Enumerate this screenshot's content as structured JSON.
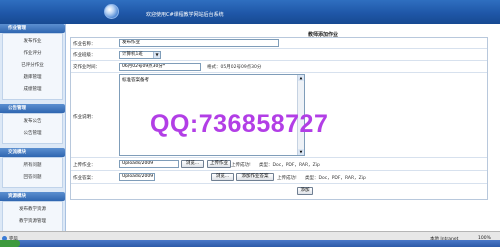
{
  "header": {
    "title": "欢迎使用C#课程教学网站后台系统"
  },
  "sidebar": {
    "sections": [
      {
        "title": "作业管理",
        "items": [
          "发布作业",
          "作业评分",
          "已评分作业",
          "题库管理",
          "成绩管理"
        ]
      },
      {
        "title": "公告管理",
        "items": [
          "发布公告",
          "公告管理"
        ]
      },
      {
        "title": "交流模块",
        "items": [
          "所有问题",
          "回答问题"
        ]
      },
      {
        "title": "资源模块",
        "items": [
          "发布教学资源",
          "教学资源管理"
        ]
      }
    ]
  },
  "form": {
    "page_title": "教师添加作业",
    "title_label": "作业名称：",
    "title_value": "发布作业",
    "class_label": "作业班级：",
    "class_value": "计算机1班",
    "deadline_label": "交作业时间：",
    "deadline_value": "06月02号09点30分*",
    "deadline_hint": "格式：05月02号09点30分",
    "desc_label": "作业说明：",
    "desc_value": "标准答案备考",
    "upload_label": "上传作业：",
    "upload_value": "Uploads/2009",
    "browse_label": "浏览...",
    "upload_button": "上传作业",
    "upload_status": "上传成功!",
    "upload_types": "类型：Doc，PDF，RAR，Zip",
    "answer_label": "作业答案：",
    "answer_value": "Uploads/2009",
    "answer_browse_label": "浏览...",
    "answer_button": "添加作业答案",
    "answer_status": "上传成功!",
    "answer_types": "类型：Doc，PDF，RAR，Zip",
    "submit_label": "添加"
  },
  "watermark": "QQ:736858727",
  "statusbar": {
    "done": "完毕",
    "zone": "本地 Intranet",
    "zoom": "100%"
  },
  "icons": {
    "banner_logo": "globe-icon",
    "browser": "ie-icon"
  },
  "colors": {
    "banner": "#1f57a8",
    "sidebar_head": "#2f66b0",
    "watermark": "#b23ee6"
  }
}
